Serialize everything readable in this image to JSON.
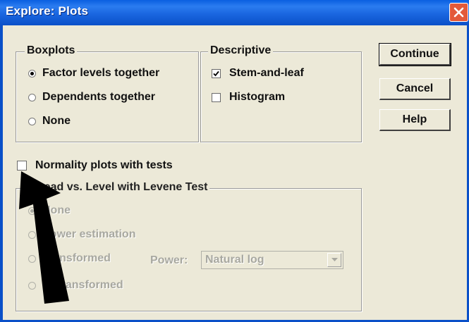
{
  "window": {
    "title": "Explore: Plots"
  },
  "boxplots": {
    "label": "Boxplots",
    "options": [
      "Factor levels together",
      "Dependents together",
      "None"
    ],
    "selected": "Factor levels together"
  },
  "descriptive": {
    "label": "Descriptive",
    "options": [
      {
        "label": "Stem-and-leaf",
        "checked": true
      },
      {
        "label": "Histogram",
        "checked": false
      }
    ]
  },
  "buttons": {
    "continue": "Continue",
    "cancel": "Cancel",
    "help": "Help"
  },
  "normality": {
    "label": "Normality plots with tests",
    "checked": false
  },
  "spread": {
    "label": "Spread vs. Level with Levene Test",
    "options": [
      "None",
      "Power estimation",
      "Transformed",
      "Untransformed"
    ],
    "selected": "None",
    "power_label": "Power:",
    "power_value": "Natural log"
  },
  "icons": {
    "close": "close-icon",
    "dropdown": "chevron-down-icon",
    "pointer": "arrow-pointer-icon"
  },
  "colors": {
    "titlebar": "#0a5fe0",
    "close": "#e35a3a",
    "dialog_bg": "#ece9d8",
    "disabled_text": "#a8a8a0"
  }
}
